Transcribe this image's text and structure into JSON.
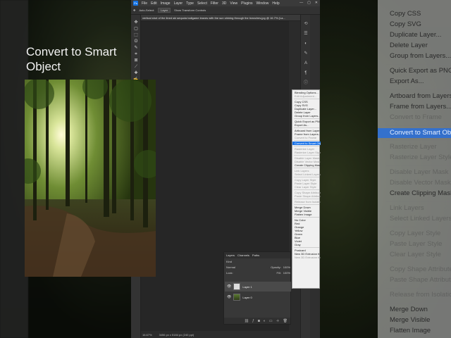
{
  "app": {
    "menu": [
      "File",
      "Edit",
      "Image",
      "Layer",
      "Type",
      "Select",
      "Filter",
      "3D",
      "View",
      "Plugins",
      "Window",
      "Help"
    ],
    "logo": "Ps",
    "window_controls": [
      "—",
      "▢",
      "✕"
    ]
  },
  "options_bar": {
    "auto_select_label": "Auto-Select:",
    "auto_select_value": "Layer",
    "transform_label": "Show Transform Controls"
  },
  "document": {
    "tab_title": "vertical shot of the lined ski sequoia ballgame leaves with the sun shining through the branches.jpg @ 16.7% (La..."
  },
  "overlay": {
    "title": "Convert to Smart Object"
  },
  "layers_panel": {
    "tabs": [
      "Layers",
      "Channels",
      "Paths"
    ],
    "kind_label": "Kind",
    "blend_mode": "Normal",
    "opacity_label": "Opacity:",
    "opacity_value": "100%",
    "lock_label": "Lock:",
    "fill_label": "Fill:",
    "fill_value": "100%",
    "layers": [
      {
        "name": "Layer 1",
        "selected": true
      },
      {
        "name": "Layer 0",
        "selected": false
      }
    ]
  },
  "status_bar": {
    "zoom": "16.67%",
    "dimensions": "3456 px x 5184 px (240 ppi)"
  },
  "context_menu": {
    "items": [
      {
        "label": "Blending Options...",
        "disabled": false
      },
      {
        "label": "Edit Adjustment...",
        "disabled": true
      },
      {
        "sep": true
      },
      {
        "label": "Copy CSS",
        "disabled": false
      },
      {
        "label": "Copy SVG",
        "disabled": false
      },
      {
        "label": "Duplicate Layer...",
        "disabled": false
      },
      {
        "label": "Delete Layer",
        "disabled": false
      },
      {
        "label": "Group from Layers...",
        "disabled": false
      },
      {
        "sep": true
      },
      {
        "label": "Quick Export as PNG",
        "disabled": false
      },
      {
        "label": "Export As...",
        "disabled": false
      },
      {
        "sep": true
      },
      {
        "label": "Artboard from Layers...",
        "disabled": false
      },
      {
        "label": "Frame from Layers...",
        "disabled": false
      },
      {
        "label": "Convert to Frame",
        "disabled": true
      },
      {
        "sep": true
      },
      {
        "label": "Convert to Smart Object",
        "disabled": false,
        "highlighted": true
      },
      {
        "sep": true
      },
      {
        "label": "Rasterize Layer",
        "disabled": true
      },
      {
        "label": "Rasterize Layer Style",
        "disabled": true
      },
      {
        "sep": true
      },
      {
        "label": "Disable Layer Mask",
        "disabled": true
      },
      {
        "label": "Disable Vector Mask",
        "disabled": true
      },
      {
        "label": "Create Clipping Mask",
        "disabled": false
      },
      {
        "sep": true
      },
      {
        "label": "Link Layers",
        "disabled": true
      },
      {
        "label": "Select Linked Layers",
        "disabled": true
      },
      {
        "sep": true
      },
      {
        "label": "Copy Layer Style",
        "disabled": true
      },
      {
        "label": "Paste Layer Style",
        "disabled": true
      },
      {
        "label": "Clear Layer Style",
        "disabled": true
      },
      {
        "sep": true
      },
      {
        "label": "Copy Shape Attributes",
        "disabled": true
      },
      {
        "label": "Paste Shape Attributes",
        "disabled": true
      },
      {
        "sep": true
      },
      {
        "label": "Release from Isolation",
        "disabled": true
      },
      {
        "sep": true
      },
      {
        "label": "Merge Down",
        "disabled": false
      },
      {
        "label": "Merge Visible",
        "disabled": false
      },
      {
        "label": "Flatten Image",
        "disabled": false
      },
      {
        "sep": true
      },
      {
        "label": "No Color",
        "disabled": false
      },
      {
        "label": "Red",
        "disabled": false
      },
      {
        "label": "Orange",
        "disabled": false
      },
      {
        "label": "Yellow",
        "disabled": false
      },
      {
        "label": "Green",
        "disabled": false
      },
      {
        "label": "Blue",
        "disabled": false
      },
      {
        "label": "Violet",
        "disabled": false
      },
      {
        "label": "Gray",
        "disabled": false
      },
      {
        "sep": true
      },
      {
        "label": "Postcard",
        "disabled": false
      },
      {
        "label": "New 3D Extrusion from Selected Layer",
        "disabled": false
      },
      {
        "label": "New 3D Extrusion from Current Selection",
        "disabled": true
      }
    ]
  },
  "zoomed_menu": {
    "items": [
      {
        "label": "Copy CSS",
        "disabled": false
      },
      {
        "label": "Copy SVG",
        "disabled": false
      },
      {
        "label": "Duplicate Layer...",
        "disabled": false
      },
      {
        "label": "Delete Layer",
        "disabled": false
      },
      {
        "label": "Group from Layers...",
        "disabled": false
      },
      {
        "sep": true
      },
      {
        "label": "Quick Export as PNG",
        "disabled": false
      },
      {
        "label": "Export As...",
        "disabled": false
      },
      {
        "sep": true
      },
      {
        "label": "Artboard from Layers...",
        "disabled": false
      },
      {
        "label": "Frame from Layers...",
        "disabled": false
      },
      {
        "label": "Convert to Frame",
        "disabled": true
      },
      {
        "sep": true
      },
      {
        "label": "Convert to Smart Object",
        "disabled": false,
        "highlighted": true
      },
      {
        "sep": true
      },
      {
        "label": "Rasterize Layer",
        "disabled": true
      },
      {
        "label": "Rasterize Layer Style",
        "disabled": true
      },
      {
        "sep": true
      },
      {
        "label": "Disable Layer Mask",
        "disabled": true
      },
      {
        "label": "Disable Vector Mask",
        "disabled": true
      },
      {
        "label": "Create Clipping Mask",
        "disabled": false
      },
      {
        "sep": true
      },
      {
        "label": "Link Layers",
        "disabled": true
      },
      {
        "label": "Select Linked Layers",
        "disabled": true
      },
      {
        "sep": true
      },
      {
        "label": "Copy Layer Style",
        "disabled": true
      },
      {
        "label": "Paste Layer Style",
        "disabled": true
      },
      {
        "label": "Clear Layer Style",
        "disabled": true
      },
      {
        "sep": true
      },
      {
        "label": "Copy Shape Attributes",
        "disabled": true
      },
      {
        "label": "Paste Shape Attributes",
        "disabled": true
      },
      {
        "sep": true
      },
      {
        "label": "Release from Isolation",
        "disabled": true
      },
      {
        "sep": true
      },
      {
        "label": "Merge Down",
        "disabled": false
      },
      {
        "label": "Merge Visible",
        "disabled": false
      },
      {
        "label": "Flatten Image",
        "disabled": false
      }
    ]
  },
  "colors": {
    "highlight": "#1a73e8",
    "panel": "#2b2b2b",
    "menu_bg": "#f0f0f0"
  }
}
